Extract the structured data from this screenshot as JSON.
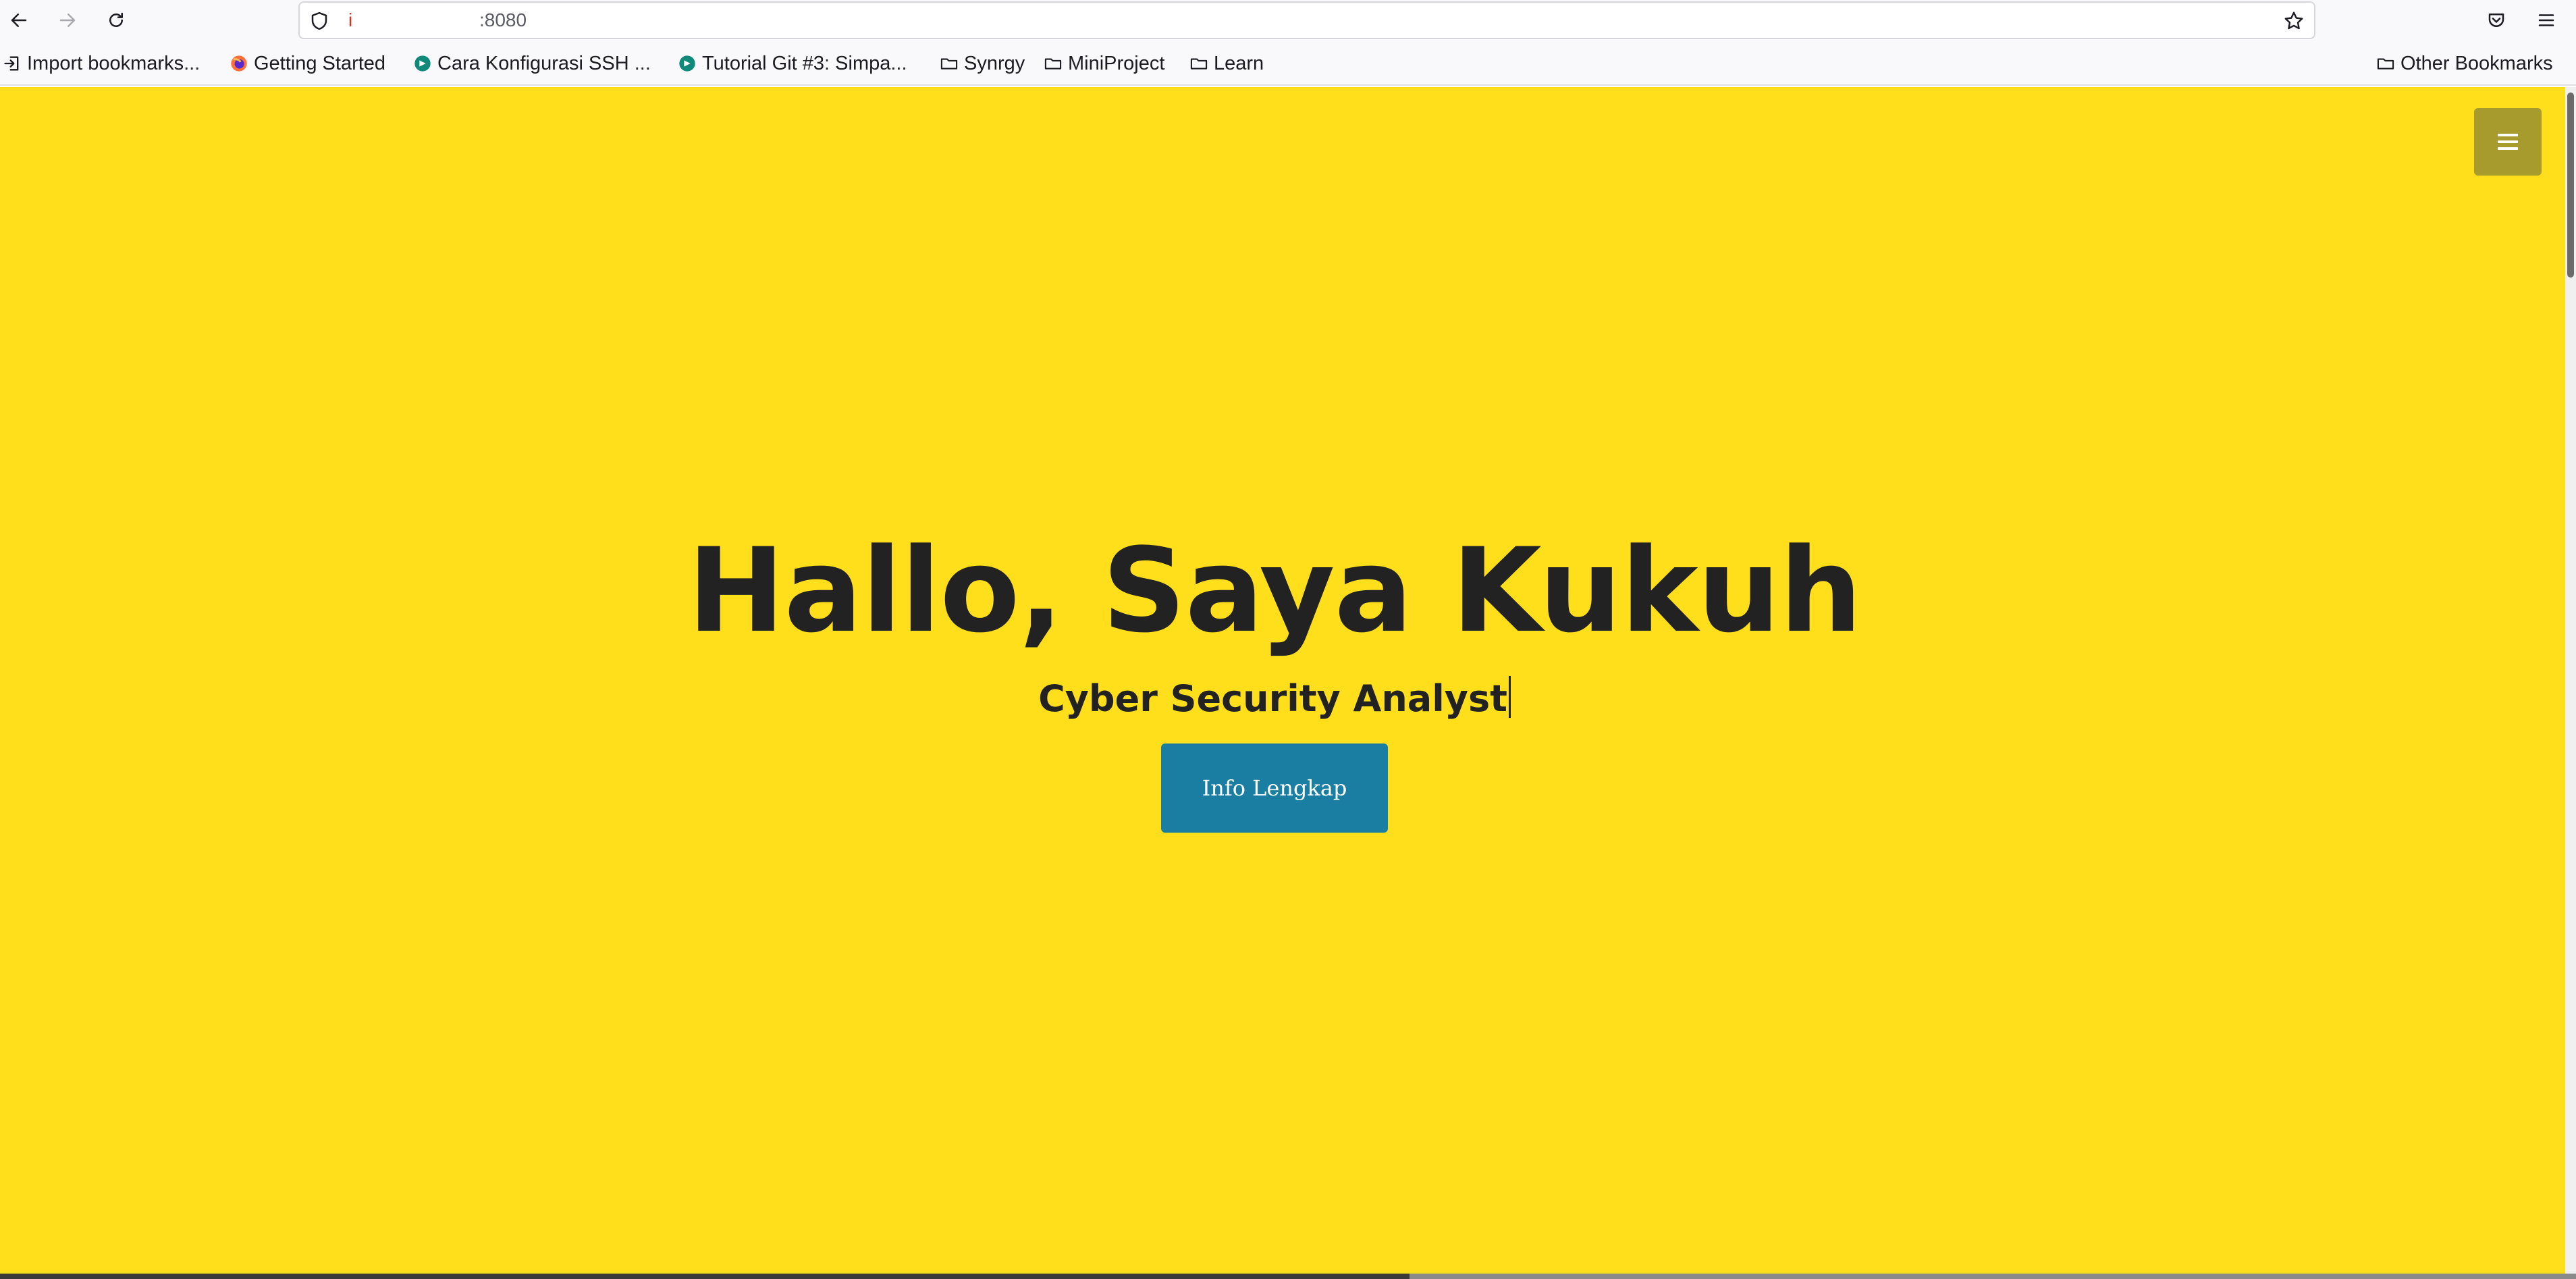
{
  "browser": {
    "url_prefix": "i",
    "url_text": ":8080",
    "bookmarks": [
      {
        "label": "Import bookmarks...",
        "icon": "import-icon"
      },
      {
        "label": "Getting Started",
        "icon": "firefox-icon"
      },
      {
        "label": "Cara Konfigurasi SSH ...",
        "icon": "site-favicon"
      },
      {
        "label": "Tutorial Git #3: Simpa...",
        "icon": "site-favicon"
      },
      {
        "label": "Synrgy",
        "icon": "folder-icon"
      },
      {
        "label": "MiniProject",
        "icon": "folder-icon"
      },
      {
        "label": "Learn",
        "icon": "folder-icon"
      }
    ],
    "other_bookmarks": "Other Bookmarks"
  },
  "page": {
    "background_color": "#ffde1c",
    "hero": {
      "title": "Hallo, Saya Kukuh",
      "subtitle": "Cyber Security Analyst",
      "button_label": "Info Lengkap",
      "button_color": "#1a7ea2"
    },
    "menu_toggle_color": "#a89b2e"
  }
}
